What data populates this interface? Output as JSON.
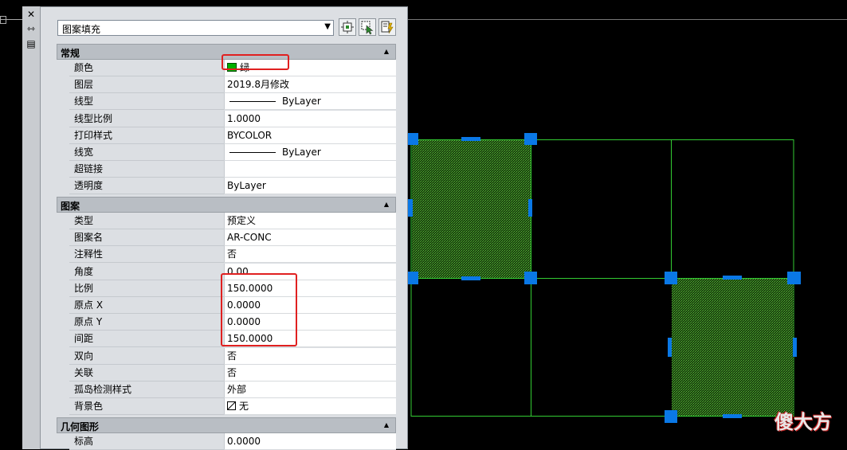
{
  "palette": {
    "selector": {
      "value": "图案填充",
      "arrow": "▼"
    },
    "toolbar": {
      "close_label": "✕",
      "autohide_label": "⇿",
      "properties_label": "▤"
    },
    "sections": [
      {
        "title": "常规",
        "rows": [
          {
            "name": "颜色",
            "value": "绿",
            "kind": "color"
          },
          {
            "name": "图层",
            "value": "2019.8月修改"
          },
          {
            "name": "线型",
            "value": "ByLayer",
            "kind": "linetype"
          },
          {
            "name": "线型比例",
            "value": "1.0000"
          },
          {
            "name": "打印样式",
            "value": "BYCOLOR"
          },
          {
            "name": "线宽",
            "value": "ByLayer",
            "kind": "linetype"
          },
          {
            "name": "超链接",
            "value": ""
          },
          {
            "name": "透明度",
            "value": "ByLayer"
          }
        ]
      },
      {
        "title": "图案",
        "rows": [
          {
            "name": "类型",
            "value": "预定义"
          },
          {
            "name": "图案名",
            "value": "AR-CONC"
          },
          {
            "name": "注释性",
            "value": "否"
          },
          {
            "name": "角度",
            "value": "0.00"
          },
          {
            "name": "比例",
            "value": "150.0000"
          },
          {
            "name": "原点 X",
            "value": "0.0000"
          },
          {
            "name": "原点 Y",
            "value": "0.0000"
          },
          {
            "name": "间距",
            "value": "150.0000"
          },
          {
            "name": "双向",
            "value": "否"
          },
          {
            "name": "关联",
            "value": "否"
          },
          {
            "name": "孤岛检测样式",
            "value": "外部"
          },
          {
            "name": "背景色",
            "value": "无",
            "kind": "nofill"
          }
        ]
      },
      {
        "title": "几何图形",
        "rows": [
          {
            "name": "标高",
            "value": "0.0000"
          }
        ]
      }
    ]
  },
  "canvas": {
    "background": "#000000",
    "line_color": "#33cc33",
    "hatch_color": "#2f7a1c",
    "grip_color": "#0a78e6"
  },
  "watermark": {
    "text": "傻大方"
  }
}
